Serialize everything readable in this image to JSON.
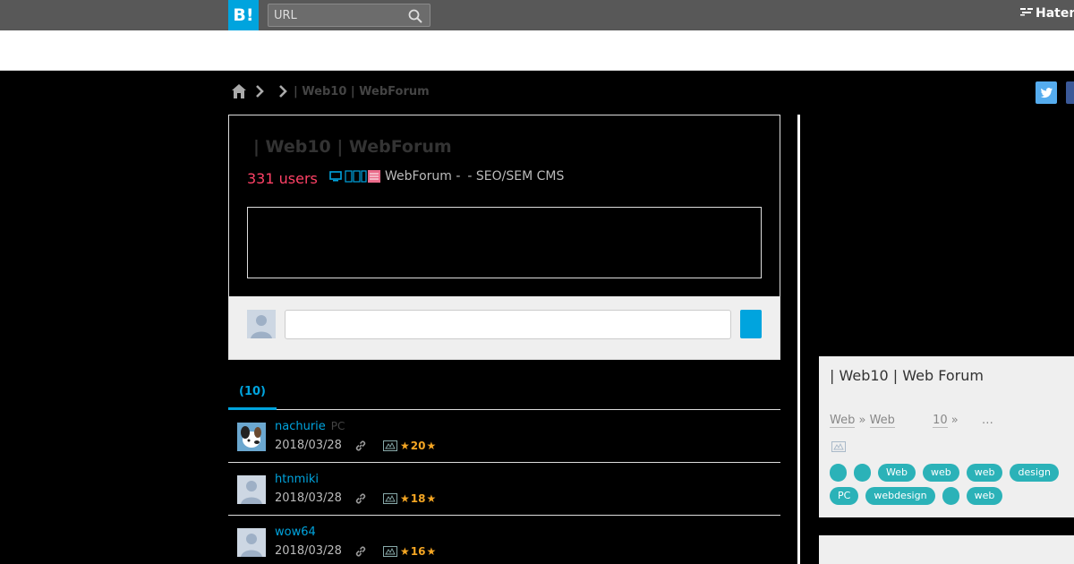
{
  "topbar": {
    "logo_text": "B!",
    "search_placeholder": "URL",
    "brand_text": "Hatena",
    "brand_color": "#585858",
    "accent_color": "#00a4de"
  },
  "breadcrumb": {
    "icons": [
      "home-icon",
      "chevron-right-icon",
      "chevron-right-icon"
    ],
    "title": "| Web10 | WebForum"
  },
  "entry": {
    "title": "| Web10 | WebForum",
    "users": "331 users",
    "site": "WebForum -",
    "description": "- SEO/SEM  CMS",
    "users_color": "#ff4166"
  },
  "tabs": [
    {
      "label": "(10)"
    }
  ],
  "bookmarks": [
    {
      "user": "nachurie",
      "device": "PC",
      "date": "2018/03/28",
      "stars": "20"
    },
    {
      "user": "htnmiki",
      "device": "",
      "date": "2018/03/28",
      "stars": "18"
    },
    {
      "user": "wow64",
      "device": "",
      "date": "2018/03/28",
      "stars": "16"
    }
  ],
  "related": {
    "title": "| Web10 | Web Forum",
    "cat_a": "Web",
    "cat_sep": "»",
    "cat_b": "Web",
    "count": "10",
    "count_suffix": "»",
    "more": "…",
    "tags": [
      "",
      "",
      "Web",
      "web",
      "web",
      "design",
      "PC",
      "webdesign",
      "",
      "web"
    ],
    "tag_color": "#2bb2b8"
  }
}
